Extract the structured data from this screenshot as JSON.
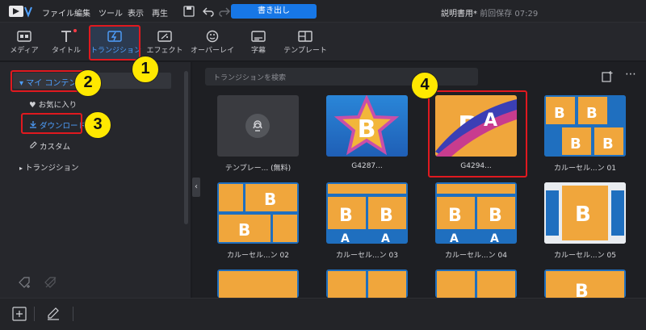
{
  "menubar": {
    "items": [
      "ファイル",
      "編集",
      "ツール",
      "表示",
      "再生"
    ],
    "export_label": "書き出し",
    "project_title": "説明書用*",
    "saved_status": "前回保存 07:29"
  },
  "tabs": [
    {
      "label": "メディア"
    },
    {
      "label": "タイトル"
    },
    {
      "label": "トランジション"
    },
    {
      "label": "エフェクト"
    },
    {
      "label": "オーバーレイ"
    },
    {
      "label": "字幕"
    },
    {
      "label": "テンプレート"
    }
  ],
  "tree": {
    "my_content": "マイ コンテンツ",
    "favorites": "お気に入り",
    "download": "ダウンロード",
    "custom": "カスタム",
    "transitions": "トランジション"
  },
  "search": {
    "placeholder": "トランジションを検索"
  },
  "callouts": [
    "1",
    "2",
    "3",
    "4"
  ],
  "grid": [
    {
      "caption": "テンプレー... (無料)"
    },
    {
      "caption": "G4287..."
    },
    {
      "caption": "G4294..."
    },
    {
      "caption": "カルーセル...ン 01"
    },
    {
      "caption": "カルーセル...ン 02"
    },
    {
      "caption": "カルーセル...ン 03"
    },
    {
      "caption": "カルーセル...ン 04"
    },
    {
      "caption": "カルーセル...ン 05"
    },
    {
      "caption": ""
    },
    {
      "caption": ""
    },
    {
      "caption": ""
    },
    {
      "caption": ""
    }
  ],
  "thumb_text": {
    "letter_b": "B",
    "letter_a": "A"
  },
  "colors": {
    "accent": "#1777e6",
    "highlight": "#e0191f",
    "callout": "#ffe800"
  }
}
